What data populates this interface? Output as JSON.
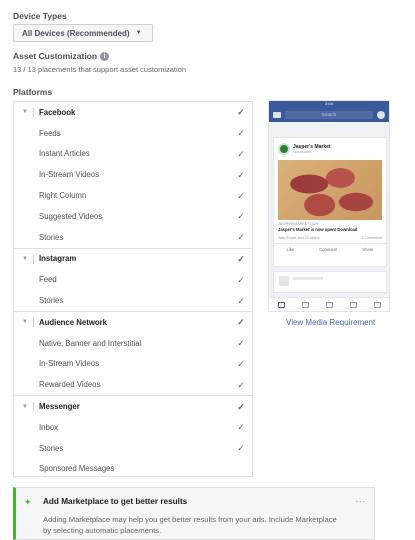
{
  "device_types": {
    "label": "Device Types",
    "selected": "All Devices (Recommended)"
  },
  "asset_customization": {
    "label": "Asset Customization",
    "info_icon": "i",
    "summary": "13 / 13 placements that support asset customization"
  },
  "platforms": {
    "label": "Platforms",
    "groups": [
      {
        "name": "Facebook",
        "checked": true,
        "items": [
          {
            "label": "Feeds",
            "checked": true
          },
          {
            "label": "Instant Articles",
            "checked": true
          },
          {
            "label": "In-Stream Videos",
            "checked": true
          },
          {
            "label": "Right Column",
            "checked": true
          },
          {
            "label": "Suggested Videos",
            "checked": true
          },
          {
            "label": "Stories",
            "checked": true
          }
        ]
      },
      {
        "name": "Instagram",
        "checked": true,
        "items": [
          {
            "label": "Feed",
            "checked": true
          },
          {
            "label": "Stories",
            "checked": true
          }
        ]
      },
      {
        "name": "Audience Network",
        "checked": true,
        "items": [
          {
            "label": "Native, Banner and Interstitial",
            "checked": true
          },
          {
            "label": "In-Stream Videos",
            "checked": true
          },
          {
            "label": "Rewarded Videos",
            "checked": true
          }
        ]
      },
      {
        "name": "Messenger",
        "checked": true,
        "items": [
          {
            "label": "Inbox",
            "checked": true
          },
          {
            "label": "Stories",
            "checked": true
          },
          {
            "label": "Sponsored Messages",
            "checked": false
          }
        ]
      }
    ]
  },
  "preview": {
    "status_time": "2:04",
    "search_placeholder": "Search",
    "page_name": "Jasper's Market",
    "sponsored": "Sponsored",
    "url": "JASPERSMARKET.COM",
    "headline": "Jasper's Market is now open! Download",
    "reactions": "Jake Evans and 22 others",
    "comments": "2 Comments",
    "like": "Like",
    "comment": "Comment",
    "share": "Share"
  },
  "view_media_requirement": "View Media Requirement",
  "banner": {
    "title": "Add Marketplace to get better results",
    "body": "Adding Marketplace may help you get better results from your ads. Include Marketplace by selecting automatic placements.",
    "more": "..."
  },
  "colors": {
    "facebook_blue": "#3b5998",
    "link": "#4267b2",
    "accent_green": "#42b72a"
  }
}
